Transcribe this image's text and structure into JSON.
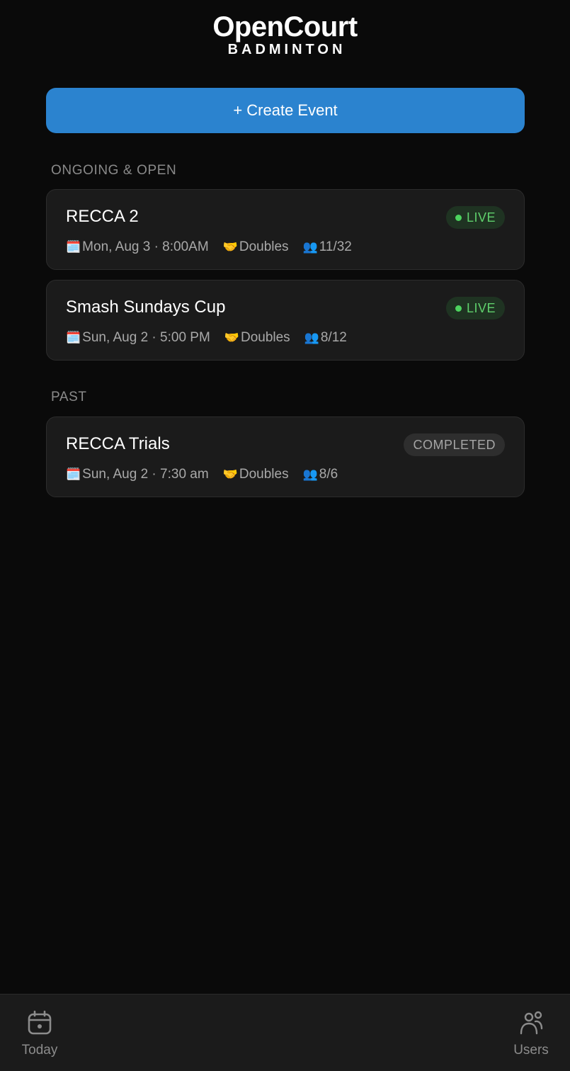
{
  "brand": {
    "name": "OpenCourt",
    "sub": "BADMINTON"
  },
  "create_button": {
    "label": "+ Create Event"
  },
  "sections": {
    "ongoing": "ONGOING & OPEN",
    "past": "PAST"
  },
  "events": [
    {
      "title": "RECCA 2",
      "date": "Mon, Aug 3 · 8:00AM",
      "format": "Doubles",
      "players": "11/32",
      "status": "LIVE"
    },
    {
      "title": "Smash Sundays Cup",
      "date": "Sun, Aug 2 · 5:00 PM",
      "format": "Doubles",
      "players": "8/12",
      "status": "LIVE"
    },
    {
      "title": "RECCA Trials",
      "date": "Sun, Aug 2 · 7:30 am",
      "format": "Doubles",
      "players": "8/6",
      "status": "COMPLETED"
    }
  ],
  "icons": {
    "date": "calendar-emoji",
    "format": "handshake-emoji",
    "players": "busts-emoji"
  },
  "tabs": [
    {
      "label": "Today",
      "icon": "calendar-icon"
    },
    {
      "label": "Users",
      "icon": "users-icon"
    }
  ],
  "colors": {
    "accent": "#2b83cf",
    "live": "#4cd35e",
    "background": "#0a0a0a",
    "card": "#1b1b1b"
  }
}
